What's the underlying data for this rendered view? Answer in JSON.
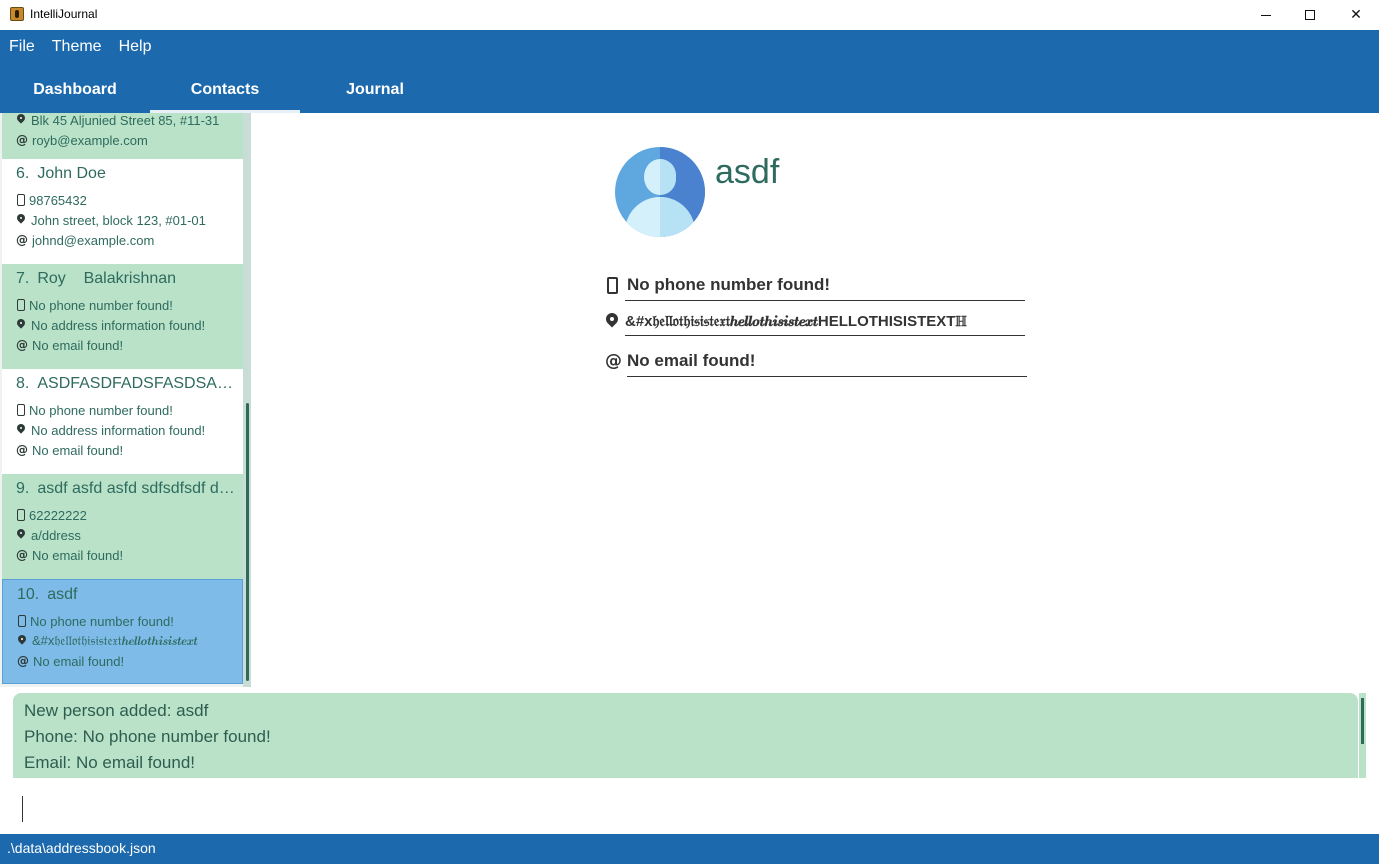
{
  "window": {
    "title": "IntelliJournal",
    "controls": {
      "minimize": "minimize",
      "maximize": "maximize",
      "close": "✕"
    }
  },
  "menu": [
    "File",
    "Theme",
    "Help"
  ],
  "tabs": [
    {
      "label": "Dashboard",
      "active": false
    },
    {
      "label": "Contacts",
      "active": true
    },
    {
      "label": "Journal",
      "active": false
    }
  ],
  "contacts": [
    {
      "index": "",
      "name": "",
      "phone": "",
      "address": "Blk 45 Aljunied Street 85, #11-31",
      "email": "royb@example.com",
      "style": "green"
    },
    {
      "index": "6.",
      "name": "John Doe",
      "phone": "98765432",
      "address": "John street, block 123, #01-01",
      "email": "johnd@example.com",
      "style": "white"
    },
    {
      "index": "7.",
      "name": "Roy    Balakrishnan",
      "phone": "No phone number found!",
      "address": "No address information found!",
      "email": "No email found!",
      "style": "green"
    },
    {
      "index": "8.",
      "name": "ASDFASDFADSFASDSASDFASDF",
      "phone": "No phone number found!",
      "address": "No address information found!",
      "email": "No email found!",
      "style": "white"
    },
    {
      "index": "9.",
      "name": "asdf asfd asfd sdfsdfsdf dsfsdf",
      "phone": "62222222",
      "address": "a/ddress",
      "email": "No email found!",
      "style": "green"
    },
    {
      "index": "10.",
      "name": "asdf",
      "phone": "No phone number found!",
      "address": "&#x𝔥𝔢𝔩𝔩𝔬𝔱𝔥𝔦𝔰𝔦𝔰𝔱𝔢𝔵𝔱𝒉𝒆𝒍𝒍𝒐𝒕𝒉𝒊𝒔𝒊𝒔𝒕𝒆𝒙𝒕",
      "email": "No email found!",
      "style": "selected"
    }
  ],
  "detail": {
    "name": "asdf",
    "phone": "No phone number found!",
    "address": "&#x𝔥𝔢𝔩𝔩𝔬𝔱𝔥𝔦𝔰𝔦𝔰𝔱𝔢𝔵𝔱𝒉𝒆𝒍𝒍𝒐𝒕𝒉𝒊𝒔𝒊𝒔𝒕𝒆𝒙𝒕HELLOTHISISTEXTℍ",
    "email": "No email found!"
  },
  "result": {
    "lines": [
      "New person added: asdf",
      "Phone: No phone number found!",
      "Email: No email found!"
    ]
  },
  "command": {
    "value": ""
  },
  "status": {
    "path": ".\\data\\addressbook.json"
  },
  "colors": {
    "header": "#1c69ad",
    "card_green": "#b9e2c8",
    "card_selected": "#7ebbe9",
    "text_green": "#2e6b5e"
  }
}
